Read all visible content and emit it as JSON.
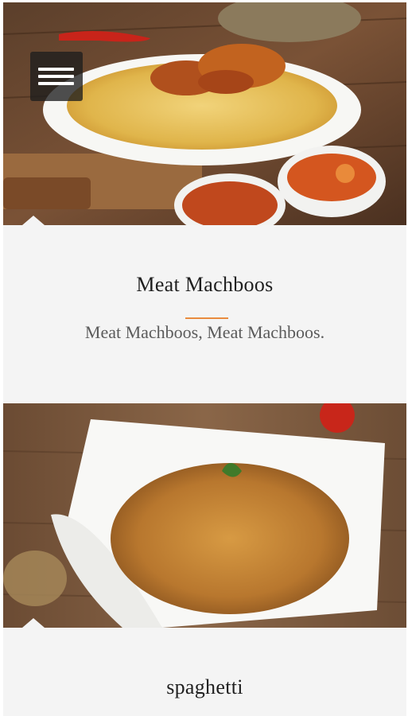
{
  "menu": {
    "icon": "hamburger-menu-icon"
  },
  "items": [
    {
      "title": "Meat Machboos",
      "description": "Meat Machboos, Meat Machboos.",
      "image": "meat-machboos-photo"
    },
    {
      "title": "spaghetti",
      "image": "spaghetti-photo"
    }
  ],
  "colors": {
    "accent": "#e98b3f",
    "card_background": "#f4f4f4",
    "title_text": "#1f1f1f",
    "description_text": "#5b5b5b"
  }
}
